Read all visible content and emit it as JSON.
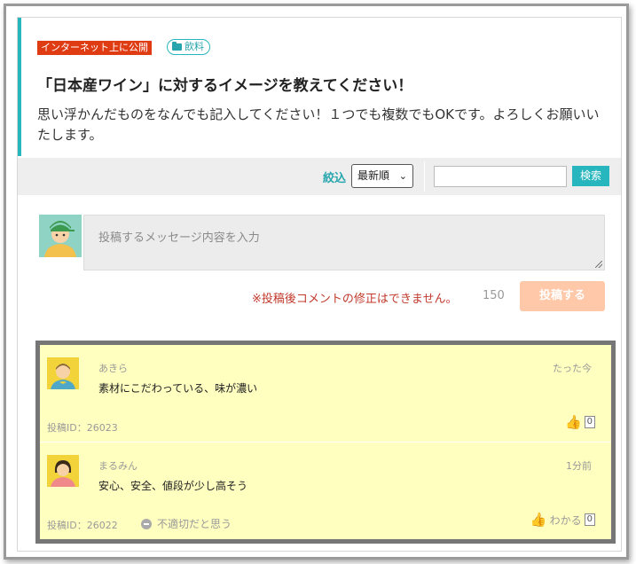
{
  "question": {
    "visibility_badge": "インターネット上に公開",
    "category_badge": "飲料",
    "title": "「日本産ワイン」に対するイメージを教えてください！",
    "description": "思い浮かんだものをなんでも記入してください！１つでも複数でもOKです。よろしくお願いいたします。"
  },
  "filter": {
    "label": "絞込",
    "sort_selected": "最新順",
    "search_placeholder": "",
    "search_button": "検索"
  },
  "compose": {
    "placeholder": "投稿するメッセージ内容を入力",
    "warning": "※投稿後コメントの修正はできません。",
    "char_count": "150",
    "submit_label": "投稿する"
  },
  "comments": [
    {
      "name": "あきら",
      "time": "たった今",
      "text": "素材にこだわっている、味が濃い",
      "post_id": "投稿ID：26023",
      "like_label": "",
      "like_count": "0",
      "report_label": ""
    },
    {
      "name": "まるみん",
      "time": "1分前",
      "text": "安心、安全、値段が少し高そう",
      "post_id": "投稿ID：26022",
      "like_label": "わかる",
      "like_count": "0",
      "report_label": "不適切だと思う"
    }
  ],
  "colors": {
    "accent": "#27b6bd",
    "public_badge": "#e03c14",
    "highlight": "#ffffc0",
    "warning": "#c0392b",
    "post_button": "#ffc8a8"
  }
}
